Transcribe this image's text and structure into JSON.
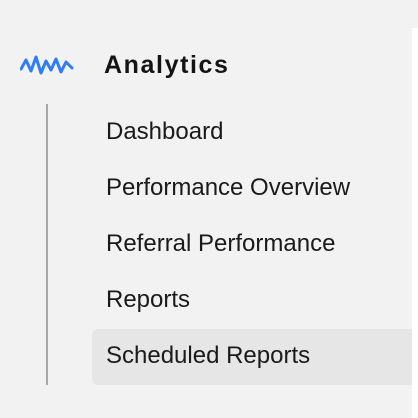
{
  "section": {
    "title": "Analytics",
    "icon": "analytics-waveform-icon",
    "accent_color": "#2f7df6"
  },
  "nav": {
    "items": [
      {
        "label": "Dashboard",
        "selected": false
      },
      {
        "label": "Performance Overview",
        "selected": false
      },
      {
        "label": "Referral Performance",
        "selected": false
      },
      {
        "label": "Reports",
        "selected": false
      },
      {
        "label": "Scheduled Reports",
        "selected": true
      }
    ]
  }
}
